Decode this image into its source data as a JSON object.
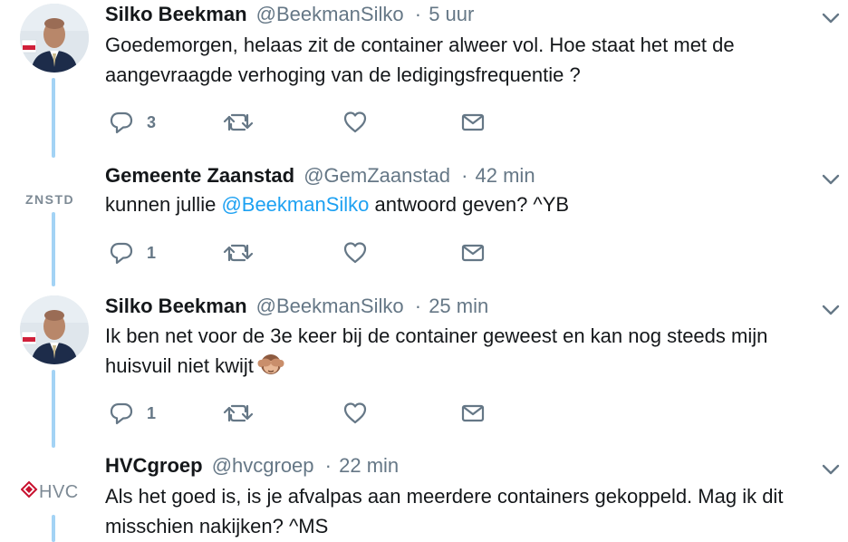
{
  "tweets": [
    {
      "name": "Silko Beekman",
      "handle": "@BeekmanSilko",
      "dot": "·",
      "time": "5 uur",
      "text": "Goedemorgen, helaas zit de container alweer vol. Hoe staat het met de aangevraagde verhoging van de ledigingsfrequentie ?",
      "reply_count": "3",
      "avatar": "person-avatar"
    },
    {
      "name": "Gemeente Zaanstad",
      "handle": "@GemZaanstad",
      "dot": "·",
      "time": "42 min",
      "text_before": "kunnen jullie ",
      "mention": "@BeekmanSilko",
      "text_after": " antwoord geven? ^YB",
      "reply_count": "1",
      "logo_text": "ZNSTD"
    },
    {
      "name": "Silko Beekman",
      "handle": "@BeekmanSilko",
      "dot": "·",
      "time": "25 min",
      "text": "Ik ben net voor de 3e keer bij de container geweest en kan nog steeds mijn huisvuil niet kwijt",
      "emoji": "see-no-evil-monkey",
      "reply_count": "1",
      "avatar": "person-avatar"
    },
    {
      "name": "HVCgroep",
      "handle": "@hvcgroep",
      "dot": "·",
      "time": "22 min",
      "text": "Als het goed is, is je afvalpas aan meerdere containers gekoppeld. Mag ik dit misschien nakijken? ^MS",
      "logo_text": "HVC"
    }
  ],
  "colors": {
    "accent": "#1da1f2",
    "thread_line": "#a3d3f5",
    "muted": "#657786",
    "icon": "#657786",
    "hvc_red": "#c8102e"
  },
  "icons": [
    "reply-icon",
    "retweet-icon",
    "like-icon",
    "direct-message-icon",
    "chevron-down-icon"
  ]
}
